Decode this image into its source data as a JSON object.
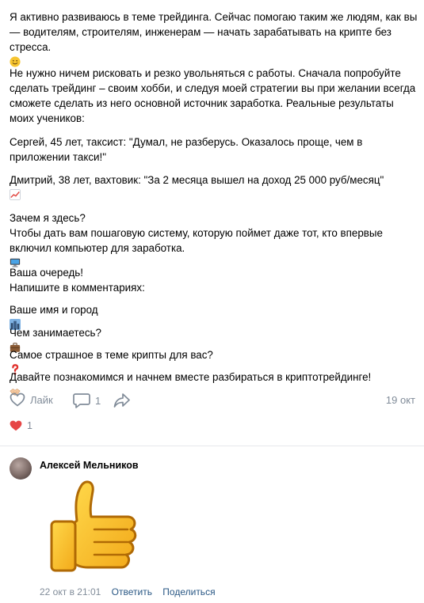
{
  "post": {
    "paragraphs": [
      {
        "text": "Я активно развиваюсь в теме трейдинга. Сейчас помогаю таким же людям, как вы — водителям, строителям, инженерам — начать зарабатывать на крипте без стресса.",
        "emoji": "smile-icon"
      },
      {
        "text": "Не нужно ничем рисковать и резко увольняться с работы. Сначала попробуйте сделать трейдинг – своим хобби, и следуя моей стратегии вы при желании всегда сможете сделать из него основной источник заработка. Реальные результаты моих учеников:"
      },
      {
        "text": "Сергей, 45 лет, таксист: \"Думал, не разберусь. Оказалось проще, чем в приложении такси!\""
      },
      {
        "text": "Дмитрий, 38 лет, вахтовик: \"За 2 месяца вышел на доход 25 000 руб/месяц\"",
        "emoji": "chart-up-icon"
      },
      {
        "text": "Зачем я здесь?\nЧтобы дать вам пошаговую систему, которую поймет даже тот, кто впервые включил компьютер для заработка.",
        "emoji": "computer-icon"
      },
      {
        "text": "Ваша очередь!\nНапишите в комментариях:"
      },
      {
        "text": "Ваше имя и город",
        "emoji": "city-icon"
      },
      {
        "text": "Чем занимаетесь?",
        "emoji": "briefcase-icon"
      },
      {
        "text": "Самое страшное в теме крипты для вас?",
        "emoji": "question-icon"
      },
      {
        "text": "Давайте познакомимся и начнем вместе разбираться в криптотрейдинге!",
        "emoji": "handshake-icon"
      }
    ]
  },
  "actions": {
    "like_label": "Лайк",
    "comment_count": "1",
    "date": "19 окт"
  },
  "reactions": {
    "count": "1"
  },
  "comment": {
    "author": "Алексей Мельников",
    "date": "22 окт в 21:01",
    "reply_label": "Ответить",
    "share_label": "Поделиться",
    "sticker": "thumbs-up-sticker"
  },
  "colors": {
    "muted": "#818c99",
    "link": "#2a5885",
    "heart": "#e64646"
  }
}
